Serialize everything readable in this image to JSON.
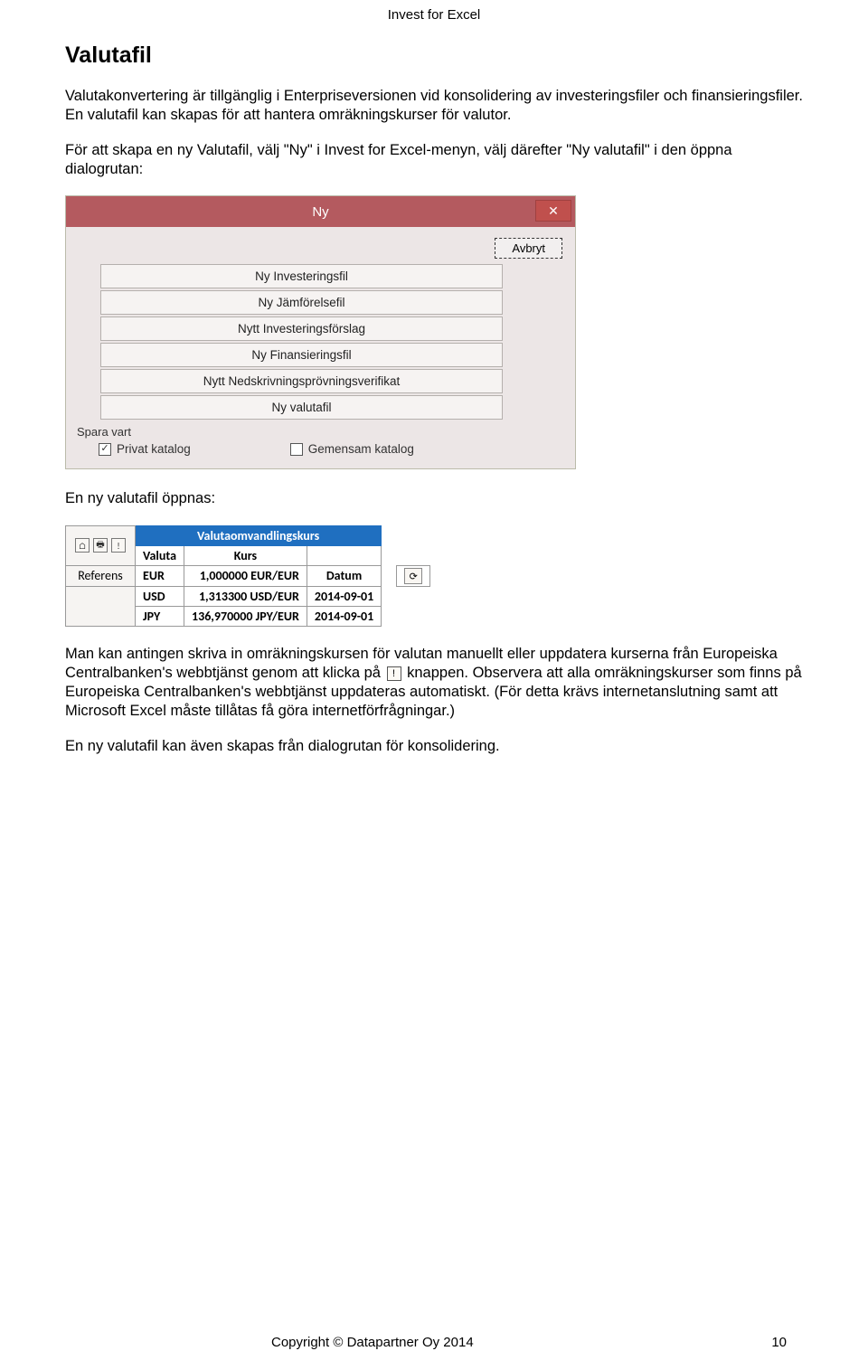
{
  "header": {
    "title": "Invest for Excel"
  },
  "section": {
    "heading": "Valutafil",
    "p1": "Valutakonvertering är tillgänglig i Enterpriseversionen vid konsolidering av investeringsfiler och finansieringsfiler. En valutafil kan skapas för att hantera omräkningskurser för valutor.",
    "p2": "För att skapa en ny Valutafil, välj \"Ny\" i Invest for Excel-menyn, välj därefter \"Ny valutafil\" i den öppna dialogrutan:",
    "p3": "En ny valutafil öppnas:",
    "p4_pre": "Man kan antingen skriva in omräkningskursen för valutan manuellt eller uppdatera kurserna från Europeiska Centralbanken's webbtjänst genom att klicka på ",
    "p4_post": " knappen. Observera att alla omräkningskurser som finns på Europeiska Centralbanken's webbtjänst uppdateras automatiskt. (För detta krävs internetanslutning samt att Microsoft Excel måste tillåtas få göra internetförfrågningar.)",
    "p5": "En ny valutafil kan även skapas från dialogrutan för konsolidering."
  },
  "dialog_ny": {
    "title": "Ny",
    "close": "✕",
    "cancel": "Avbryt",
    "options": [
      "Ny Investeringsfil",
      "Ny Jämförelsefil",
      "Nytt Investeringsförslag",
      "Ny Finansieringsfil",
      "Nytt Nedskrivningsprövningsverifikat",
      "Ny valutafil"
    ],
    "save_label": "Spara vart",
    "chk_private_checked": "✓",
    "chk_private": "Privat katalog",
    "chk_shared": "Gemensam katalog"
  },
  "valuta_table": {
    "main_header": "Valutaomvandlingskurs",
    "col_valuta": "Valuta",
    "col_kurs": "Kurs",
    "col_datum": "Datum",
    "referens": "Referens",
    "rows": [
      {
        "valuta": "EUR",
        "kurs": "1,000000 EUR/EUR",
        "datum": ""
      },
      {
        "valuta": "USD",
        "kurs": "1,313300 USD/EUR",
        "datum": "2014-09-01"
      },
      {
        "valuta": "JPY",
        "kurs": "136,970000 JPY/EUR",
        "datum": "2014-09-01"
      }
    ],
    "icon_home": "⌂",
    "icon_print": "🖶",
    "icon_exclaim": "!",
    "icon_refresh": "⟳"
  },
  "inline_icon": {
    "label": "!"
  },
  "footer": {
    "copyright": "Copyright © Datapartner Oy 2014",
    "page": "10"
  }
}
